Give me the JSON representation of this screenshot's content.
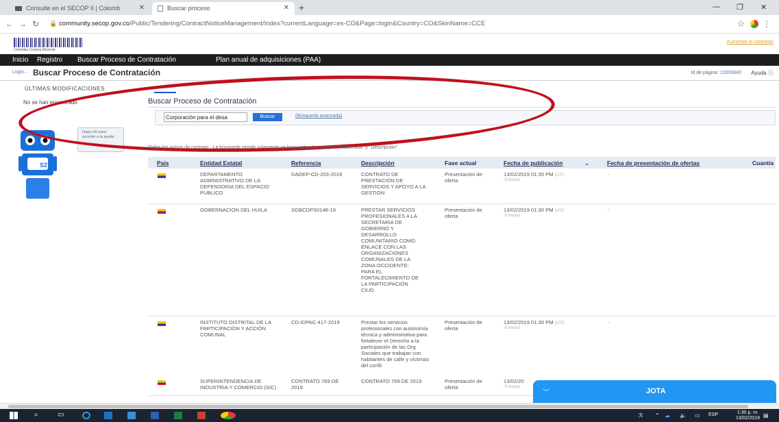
{
  "browser": {
    "tabs": [
      {
        "label": "Consulte en el SECOP II | Colomb"
      },
      {
        "label": "Buscar proceso"
      }
    ],
    "url_host": "community.secop.gov.co",
    "url_path": "/Public/Tendering/ContractNoticeManagement/Index?currentLanguage=es-CO&Page=login&Country=CO&SkinName=CCE"
  },
  "site": {
    "logo_text": "Colombia Compra Eficiente",
    "access_link": "Aumentar el contraste",
    "menu": [
      "Inicio",
      "Registro",
      "Buscar Proceso de Contratación",
      "Plan anual de adquisiciones (PAA)"
    ],
    "breadcrumb_login": "Login",
    "page_title": "Buscar Proceso de Contratación",
    "page_id_label": "Id de página:",
    "page_id_value": "12003840",
    "help": "Ayuda"
  },
  "left_panel": {
    "title": "ÚLTIMAS MODIFICACIONES",
    "empty": "No se han encontrado",
    "bubble": "Haga clic para acceder a la ayuda",
    "robot_badge": "S2"
  },
  "search": {
    "title": "Buscar Proceso de Contratación",
    "input_value": "Corporación para el desa",
    "button": "Buscar",
    "advanced": "(Búsqueda avanzada)"
  },
  "note": "Todos los avisos de contrato - La búsqueda simple solamente se hace sobre los campos \"Referencia\" y \"Descripción\"",
  "table": {
    "headers": [
      "País",
      "Entidad Estatal",
      "Referencia",
      "Descripción",
      "Fase actual",
      "Fecha de publicación",
      "Fecha de presentación de ofertas",
      "Cuantía"
    ],
    "rows": [
      {
        "entidad": "DEPARTAMENTO ADMINISTRATIVO DE LA DEFENSORIA DEL ESPACIO PUBLICO",
        "referencia": "DADEP-CD-203-2019",
        "descripcion": "CONTRATO DE PRESTACIÓN DE SERVICIOS Y APOYO A LA GESTION",
        "fase": "Presentación de oferta",
        "fecha": "13/02/2019 01:30 PM",
        "utc": "(UTC",
        "ago": "-5 horas)",
        "dash": "-"
      },
      {
        "entidad": "GOBERNACION DEL HUILA",
        "referencia": "SGBCDPS0148-19",
        "descripcion": "PRESTAR SERVICIOS PROFESIONALES A LA SECRETARIA DE GOBIERNO Y DESARROLLO COMUNITARIO COMO ENLACE CON LAS ORGANIZACIONES COMUNALES DE LA ZONA OCCIDENTE; PARA EL FORTALECIMIENTO DE LA PARTICIPACIÓN CIUD",
        "fase": "Presentación de oferta",
        "fecha": "13/02/2019 01:30 PM",
        "utc": "(UTC",
        "ago": "-5 horas)",
        "dash": "-"
      },
      {
        "entidad": "INSTITUTO DISTRITAL DE LA PARTICIPACIÓN Y ACCIÓN COMUNAL",
        "referencia": "CD-IDPAC-417-2019",
        "descripcion": "Prestar los servicios profesionales con autonomía técnica y administrativa para fortalecer el Derecho a la participación de las Org Sociales que trabajan con habitantes de calle y víctimas del confli",
        "fase": "Presentación de oferta",
        "fecha": "13/02/2019 01:30 PM",
        "utc": "(UTC",
        "ago": "-5 horas)",
        "dash": "-"
      },
      {
        "entidad": "SUPERINTENDENCIA DE INDUSTRIA Y COMERCIO (SIC)",
        "referencia": "CONTRATO 769 DE 2019",
        "descripcion": "CONTRATO 769 DE 2019",
        "fase": "Presentación de oferta",
        "fecha": "13/02/20",
        "utc": "",
        "ago": "-5 horas)",
        "dash": ""
      }
    ]
  },
  "chat": {
    "name": "JOTA"
  },
  "taskbar": {
    "lang": "ESP",
    "time": "1:30 p. m.",
    "date": "13/02/2019"
  }
}
